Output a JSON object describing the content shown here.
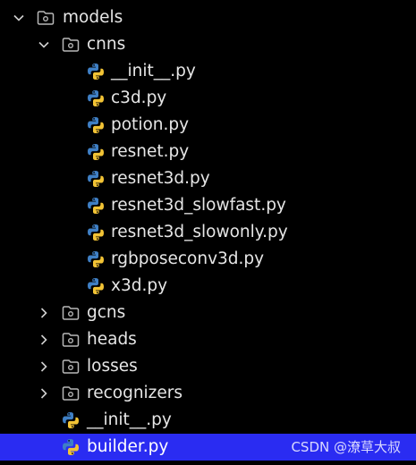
{
  "tree": {
    "models": {
      "label": "models",
      "expanded": true
    },
    "cnns": {
      "label": "cnns",
      "expanded": true,
      "files": [
        "__init__.py",
        "c3d.py",
        "potion.py",
        "resnet.py",
        "resnet3d.py",
        "resnet3d_slowfast.py",
        "resnet3d_slowonly.py",
        "rgbposeconv3d.py",
        "x3d.py"
      ]
    },
    "collapsed_folders": [
      "gcns",
      "heads",
      "losses",
      "recognizers"
    ],
    "model_files": [
      "__init__.py",
      "builder.py"
    ],
    "selected": "builder.py"
  },
  "watermark": "CSDN @潦草大叔",
  "colors": {
    "background": "#000000",
    "text": "#e6e6e6",
    "selection": "#2a2cf2",
    "folder_icon": "#b8b8b8",
    "python_blue": "#3f7fc4",
    "python_yellow": "#f2c335"
  },
  "icons": {
    "folder": "folder-icon",
    "python": "python-file-icon",
    "expanded": "chevron-down-icon",
    "collapsed": "chevron-right-icon"
  }
}
